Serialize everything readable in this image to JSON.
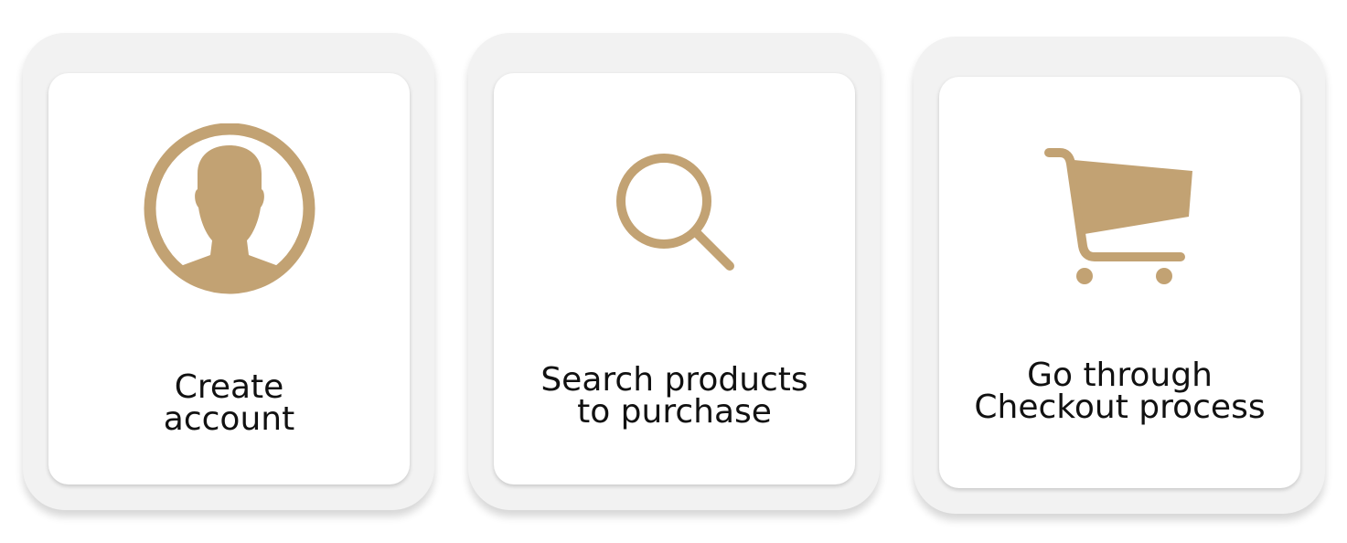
{
  "accent_color": "#c2a273",
  "steps": [
    {
      "icon": "user-avatar-icon",
      "line1": "Create",
      "line2": "account"
    },
    {
      "icon": "search-icon",
      "line1": "Search products",
      "line2": "to purchase"
    },
    {
      "icon": "shopping-cart-icon",
      "line1": "Go through",
      "line2": "Checkout process"
    }
  ]
}
